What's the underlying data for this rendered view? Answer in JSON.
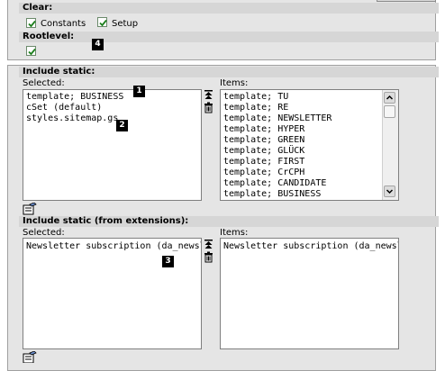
{
  "clear": {
    "header": "Clear:",
    "constants_label": "Constants",
    "constants_checked": true,
    "setup_label": "Setup",
    "setup_checked": true
  },
  "rootlevel": {
    "header": "Rootlevel:",
    "checked": true,
    "badge": "4"
  },
  "include_static": {
    "header": "Include static:",
    "selected_label": "Selected:",
    "items_label": "Items:",
    "selected": [
      "template; BUSINESS",
      "cSet (default)",
      "styles.sitemap.gs"
    ],
    "items": [
      "template; TU",
      "template; RE",
      "template; NEWSLETTER",
      "template; HYPER",
      "template; GREEN",
      "template; GLÜCK",
      "template; FIRST",
      "template; CrCPH",
      "template; CANDIDATE",
      "template; BUSINESS"
    ],
    "badge1": "1",
    "badge2": "2"
  },
  "include_static_ext": {
    "header": "Include static (from extensions):",
    "selected_label": "Selected:",
    "items_label": "Items:",
    "selected": [
      "Newsletter subscription (da_newsle"
    ],
    "items": [
      "Newsletter subscription (da_newsle"
    ],
    "badge3": "3"
  },
  "icons": {
    "move_top": "move-to-top-icon",
    "delete": "trash-icon",
    "edit": "edit-record-icon"
  }
}
